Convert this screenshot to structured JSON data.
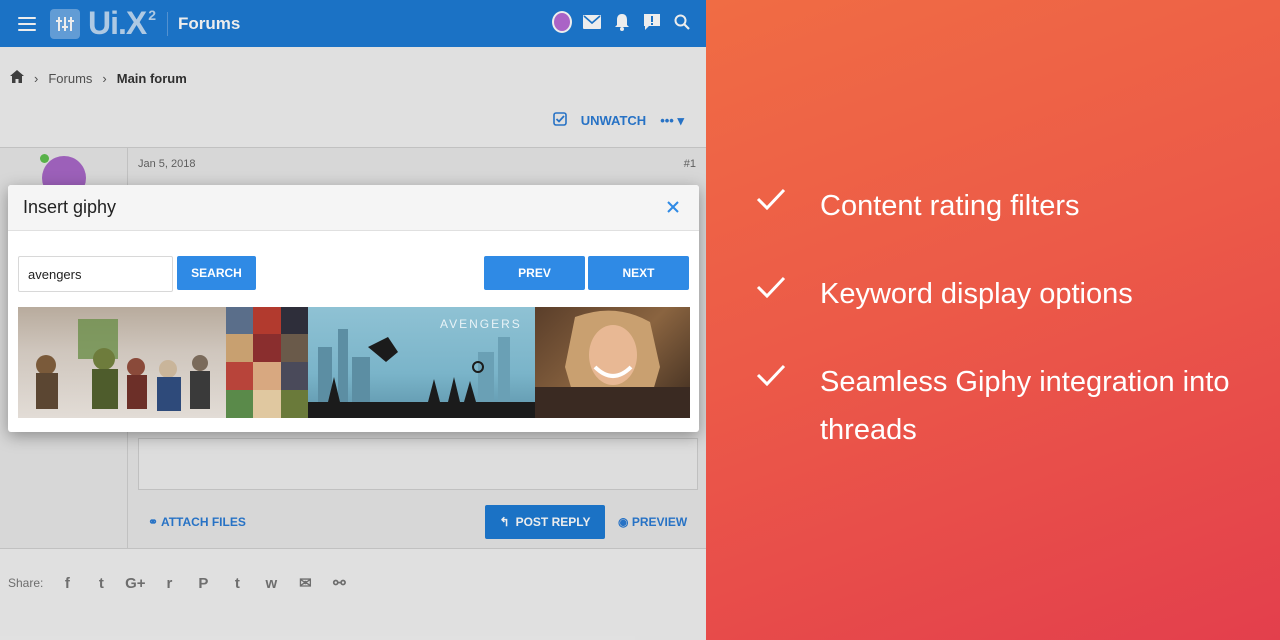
{
  "topbar": {
    "logo": "Ui.X",
    "logo_sup": "2",
    "title": "Forums",
    "icons": [
      "avatar",
      "mail-icon",
      "bell-icon",
      "message-alert-icon",
      "search-icon"
    ]
  },
  "breadcrumb": {
    "home_icon": "home-icon",
    "items": [
      "Forums",
      "Main forum"
    ]
  },
  "thread_actions": {
    "unwatch_label": "UNWATCH",
    "more_label": "•••"
  },
  "post": {
    "date": "Jan 5, 2018",
    "number": "#1",
    "attach_label": "ATTACH FILES",
    "post_reply_label": "POST REPLY",
    "preview_label": "PREVIEW"
  },
  "share": {
    "label": "Share:",
    "icons": [
      "facebook-icon",
      "twitter-icon",
      "google-plus-icon",
      "reddit-icon",
      "pinterest-icon",
      "tumblr-icon",
      "whatsapp-icon",
      "email-icon",
      "link-icon"
    ],
    "glyphs": [
      "f",
      "t",
      "G+",
      "r",
      "P",
      "t",
      "w",
      "✉",
      "⚯"
    ]
  },
  "modal": {
    "title": "Insert giphy",
    "search_value": "avengers",
    "search_button": "SEARCH",
    "prev_button": "PREV",
    "next_button": "NEXT",
    "gif_caption": "AVENGERS"
  },
  "promo": {
    "features": [
      "Content rating filters",
      "Keyword display options",
      "Seamless Giphy integration into threads"
    ]
  },
  "colors": {
    "brand_blue": "#1e7bd4",
    "button_blue": "#2f8ae5",
    "promo_start": "#f06c44",
    "promo_end": "#e33f4c"
  }
}
